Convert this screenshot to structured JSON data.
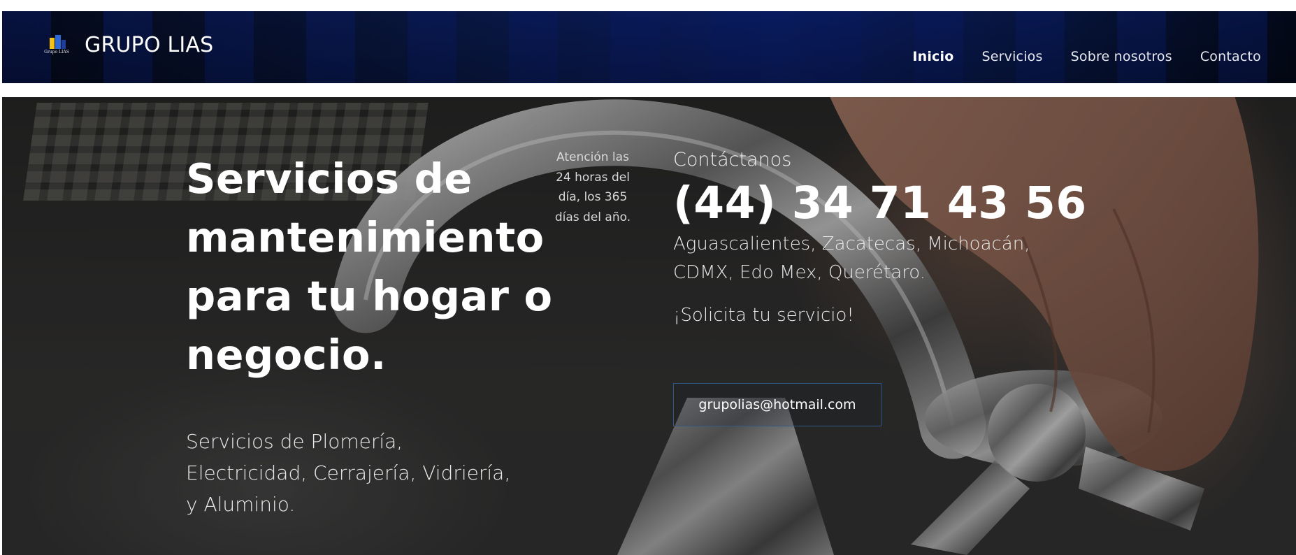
{
  "navbar": {
    "brand": "GRUPO LIAS",
    "logo_text": "Grupo LIAS",
    "links": [
      {
        "label": "Inicio",
        "active": true
      },
      {
        "label": "Servicios",
        "active": false
      },
      {
        "label": "Sobre nosotros",
        "active": false
      },
      {
        "label": "Contacto",
        "active": false
      }
    ]
  },
  "hero": {
    "headline_lines": [
      "Servicios de",
      "mantenimiento",
      "para tu hogar o",
      "negocio."
    ],
    "subtext": "Servicios de Plomería, Electricidad, Cerrajería, Vidriería, y Aluminio.",
    "attention": "Atención las 24 horas del día, los 365 días del año.",
    "contact_title": "Contáctanos",
    "phone": "(44) 34 71 43 56",
    "regions": "Aguascalientes, Zacatecas, Michoacán, CDMX, Edo Mex, Querétaro.",
    "cta": "¡Solicita tu servicio!",
    "email": "grupolias@hotmail.com"
  },
  "colors": {
    "nav_background": "#0a1a4a",
    "button_border": "#2d5a8a",
    "text": "#ffffff"
  }
}
